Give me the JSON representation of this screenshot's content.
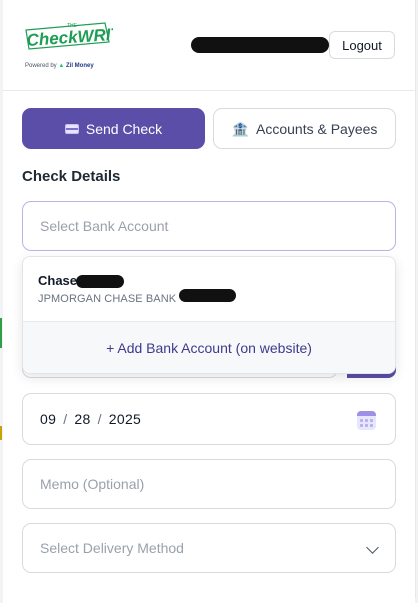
{
  "header": {
    "logo_top": "THE",
    "logo_brand": "CheckWRITER",
    "logo_powered": "Powered by",
    "logo_company": "Zil Money",
    "logout_label": "Logout"
  },
  "tabs": {
    "send_check": "Send Check",
    "accounts_payees": "Accounts & Payees"
  },
  "section_title": "Check Details",
  "bank_select": {
    "placeholder": "Select Bank Account"
  },
  "dropdown": {
    "option_name": "Chase",
    "option_bank": "JPMORGAN CHASE BANK",
    "add_label": "+ Add Bank Account (on website)"
  },
  "date": {
    "month": "09",
    "day": "28",
    "year": "2025",
    "separator": "/"
  },
  "memo": {
    "placeholder": "Memo (Optional)"
  },
  "delivery": {
    "placeholder": "Select Delivery Method"
  },
  "colors": {
    "primary": "#5b4ea8",
    "logo_green": "#1f9d55",
    "link_purple": "#3f3a8c"
  }
}
